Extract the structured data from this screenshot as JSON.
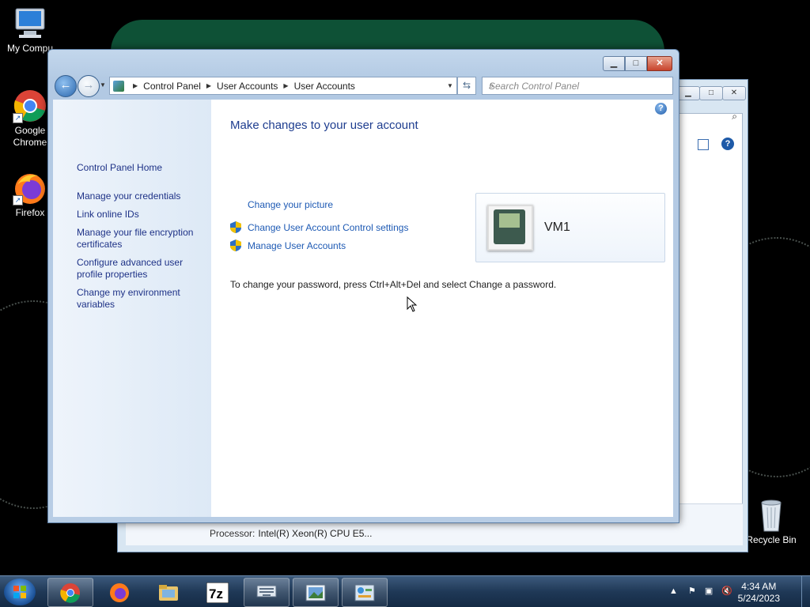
{
  "desktop": {
    "icons": [
      {
        "label": "My Compu"
      },
      {
        "label": "Google Chrome"
      },
      {
        "label": "Firefox"
      },
      {
        "label": "Recycle Bin"
      }
    ]
  },
  "background_window": {
    "processor_label": "Processor:",
    "processor_value": "Intel(R) Xeon(R) CPU E5..."
  },
  "window": {
    "caption_buttons": {
      "minimize": "▁",
      "maximize": "□",
      "close": "✕"
    },
    "breadcrumb": [
      "Control Panel",
      "User Accounts",
      "User Accounts"
    ],
    "search_placeholder": "Search Control Panel",
    "sidebar": {
      "home": "Control Panel Home",
      "links": [
        "Manage your credentials",
        "Link online IDs",
        "Manage your file encryption certificates",
        "Configure advanced user profile properties",
        "Change my environment variables"
      ]
    },
    "main": {
      "title": "Make changes to your user account",
      "links": [
        {
          "label": "Change your picture",
          "shield": false
        },
        {
          "label": "Change User Account Control settings",
          "shield": true
        },
        {
          "label": "Manage User Accounts",
          "shield": true
        }
      ],
      "account_name": "VM1",
      "password_note": "To change your password, press Ctrl+Alt+Del and select Change a password."
    }
  },
  "taskbar": {
    "items": [
      "chrome",
      "firefox",
      "file-explorer",
      "7zip",
      "on-screen-keyboard",
      "photo-viewer",
      "control-panel"
    ],
    "time": "4:34 AM",
    "date": "5/24/2023"
  },
  "colors": {
    "link": "#1e5ab4",
    "title": "#1e3d8f",
    "sidebar_link": "#1e3287"
  }
}
